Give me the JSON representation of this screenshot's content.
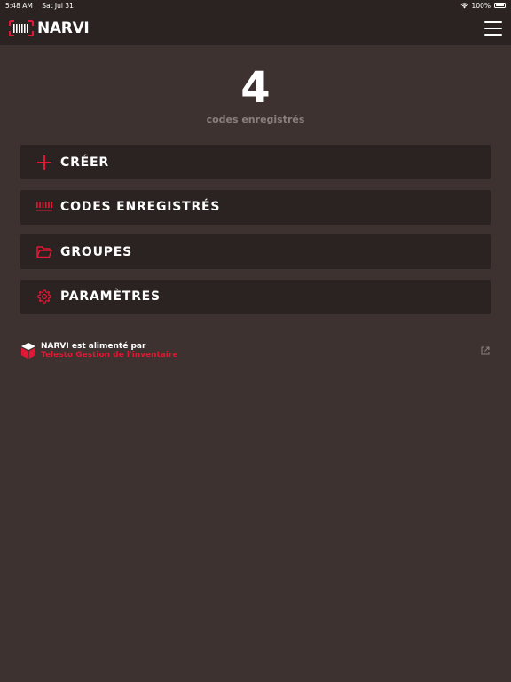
{
  "status_bar": {
    "time": "5:48 AM",
    "date": "Sat Jul 31",
    "battery": "100%"
  },
  "header": {
    "brand": "NARVI"
  },
  "summary": {
    "count": "4",
    "label": "codes enregistrés"
  },
  "menu": [
    {
      "label": "CRÉER",
      "icon": "plus-icon"
    },
    {
      "label": "CODES ENREGISTRÉS",
      "icon": "barcode-icon"
    },
    {
      "label": "GROUPES",
      "icon": "folder-icon"
    },
    {
      "label": "PARAMÈTRES",
      "icon": "gear-icon"
    }
  ],
  "footer": {
    "line1": "NARVI est alimenté par",
    "line2": "Telesto Gestion de l'inventaire"
  },
  "colors": {
    "accent": "#e01835",
    "background": "#3d3230",
    "bar": "#2a2321",
    "muted": "#8a7f7c"
  }
}
